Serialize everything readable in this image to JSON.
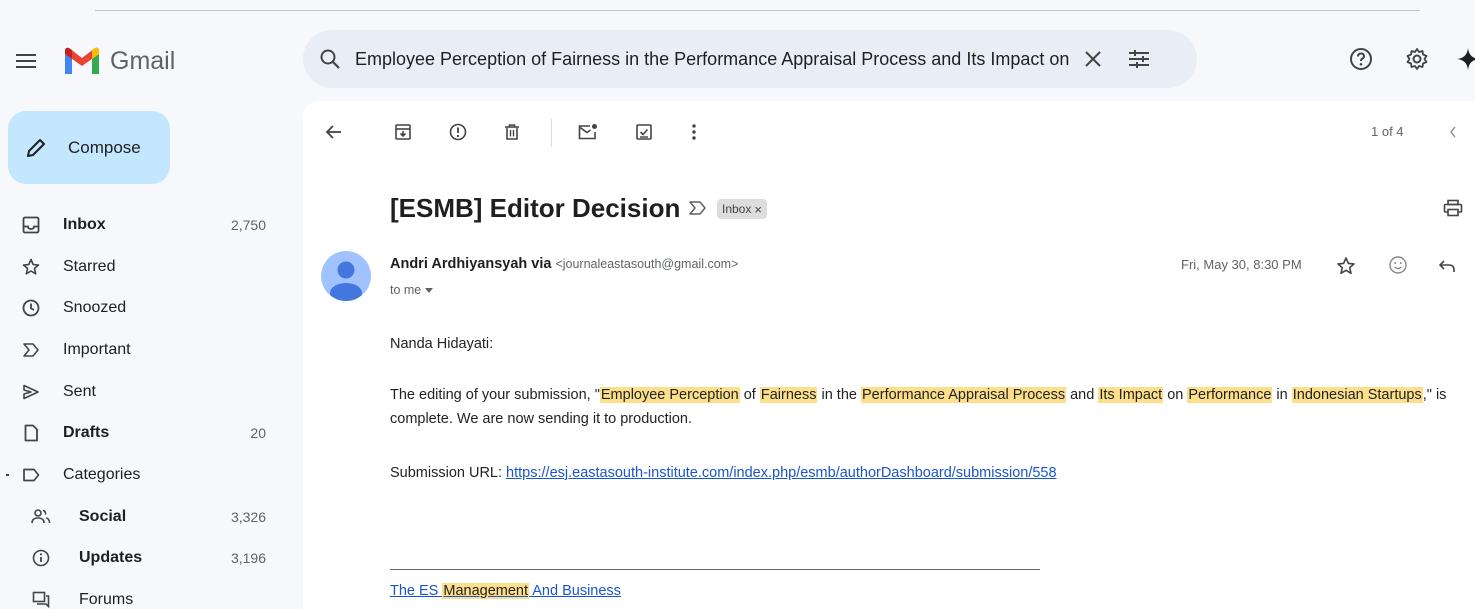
{
  "header": {
    "app_name": "Gmail",
    "search_value": "Employee Perception of Fairness in the Performance Appraisal Process and Its Impact on Performance in Indonesian Startups"
  },
  "sidebar": {
    "compose_label": "Compose",
    "items": [
      {
        "label": "Inbox",
        "count": "2,750"
      },
      {
        "label": "Starred",
        "count": ""
      },
      {
        "label": "Snoozed",
        "count": ""
      },
      {
        "label": "Important",
        "count": ""
      },
      {
        "label": "Sent",
        "count": ""
      },
      {
        "label": "Drafts",
        "count": "20"
      },
      {
        "label": "Categories",
        "count": ""
      },
      {
        "label": "Social",
        "count": "3,326"
      },
      {
        "label": "Updates",
        "count": "3,196"
      },
      {
        "label": "Forums",
        "count": ""
      }
    ]
  },
  "toolbar": {
    "pager": "1 of 4"
  },
  "email": {
    "subject": "[ESMB] Editor Decision",
    "label": "Inbox",
    "label_close": "×",
    "sender_name": "Andri Ardhiyansyah via",
    "sender_email": "<journaleastasouth@gmail.com>",
    "to": "to me",
    "date": "Fri, May 30, 8:30 PM",
    "greeting": "Nanda Hidayati:",
    "para": {
      "t0": "The editing of your submission, \"",
      "h1": "Employee Perception",
      "t1": " of ",
      "h2": "Fairness",
      "t2": " in the ",
      "h3": "Performance Appraisal Process",
      "t3": " and ",
      "h4": "Its Impact",
      "t4": " on ",
      "h5": "Performance",
      "t5": " in ",
      "h6": "Indonesian Startups",
      "t6": ",\" is complete. We are now sending it to production."
    },
    "url_label": "Submission URL: ",
    "url": "https://esj.eastasouth-institute.com/index.php/esmb/authorDashboard/submission/558",
    "sig_a": "The ES ",
    "sig_h": "Management",
    "sig_b": " And Business"
  },
  "colors": {
    "compose_bg": "#c2e7ff",
    "search_bg": "#e9eef6",
    "highlight": "#fcdf8b",
    "link": "#1a55cc"
  }
}
